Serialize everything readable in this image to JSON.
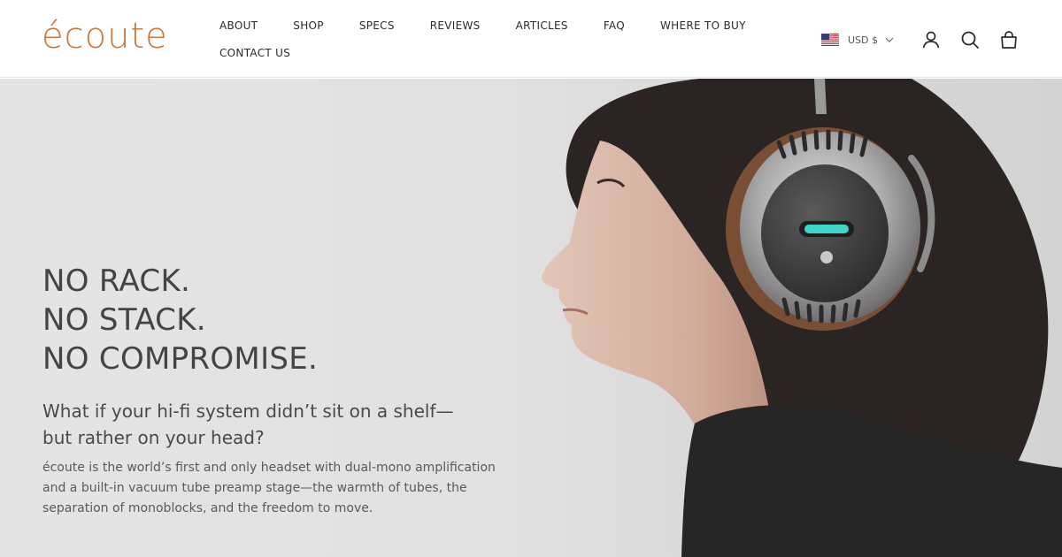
{
  "brand": {
    "logo_text": "écoute",
    "accent_color": "#c8773d"
  },
  "nav": {
    "row1": [
      "ABOUT",
      "SHOP",
      "SPECS",
      "REVIEWS",
      "ARTICLES",
      "FAQ",
      "WHERE TO BUY"
    ],
    "row2": [
      "CONTACT US"
    ]
  },
  "header_right": {
    "currency_label": "USD $",
    "flag_icon": "us-flag-icon",
    "icons": [
      "account-icon",
      "search-icon",
      "cart-icon"
    ]
  },
  "hero": {
    "headline": [
      "NO RACK.",
      "NO STACK.",
      "NO COMPROMISE."
    ],
    "subhead": [
      "What if your hi-fi system didn’t sit on a shelf—",
      "but rather on your head?"
    ],
    "body": [
      "écoute is the world’s first and only headset with dual-mono amplification",
      "and a built-in vacuum tube preamp stage—the warmth of tubes, the",
      "separation of monoblocks, and the freedom to move."
    ],
    "image_subject": "woman-wearing-headphones-photo"
  }
}
